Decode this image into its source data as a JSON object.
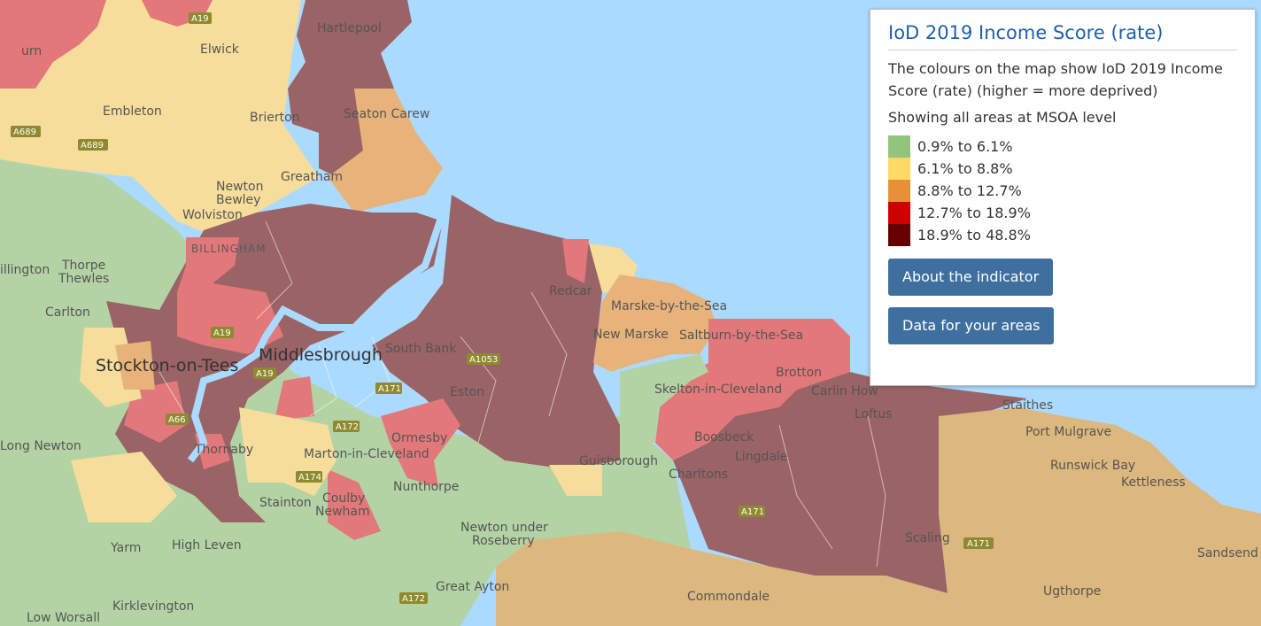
{
  "panel": {
    "title": "IoD 2019 Income Score (rate)",
    "description": "The colours on the map show IoD 2019 Income Score (rate) (higher = more deprived)",
    "level_text": "Showing all areas at MSOA level",
    "legend": [
      {
        "label": "0.9% to 6.1%",
        "color": "#93c47d"
      },
      {
        "label": "6.1% to 8.8%",
        "color": "#ffd966"
      },
      {
        "label": "8.8% to 12.7%",
        "color": "#e69138"
      },
      {
        "label": "12.7% to 18.9%",
        "color": "#cc0000"
      },
      {
        "label": "18.9% to 48.8%",
        "color": "#660000"
      }
    ],
    "buttons": {
      "about": "About the indicator",
      "data": "Data for your areas"
    }
  },
  "map": {
    "places": {
      "hartlepool": "Hartlepool",
      "elwick": "Elwick",
      "embleton": "Embleton",
      "brierton": "Brierton",
      "seaton_carew": "Seaton Carew",
      "greatham": "Greatham",
      "newton": "Newton",
      "bewley": "Bewley",
      "wolviston": "Wolviston",
      "billingham": "BILLINGHAM",
      "thorpe": "Thorpe",
      "thewles": "Thewles",
      "illington": "illington",
      "carlton": "Carlton",
      "stockton": "Stockton-on-Tees",
      "middlesbrough": "Middlesbrough",
      "south_bank": "South Bank",
      "redcar": "Redcar",
      "marske": "Marske-by-the-Sea",
      "new_marske": "New Marske",
      "saltburn": "Saltburn-by-the-Sea",
      "brotton": "Brotton",
      "carlin_how": "Carlin How",
      "loftus": "Loftus",
      "staithes": "Staithes",
      "port_mulgrave": "Port Mulgrave",
      "runswick_bay": "Runswick Bay",
      "kettleness": "Kettleness",
      "skelton": "Skelton-in-Cleveland",
      "boosbeck": "Boosbeck",
      "lingdale": "Lingdale",
      "charltons": "Charltons",
      "guisborough": "Guisborough",
      "eston": "Eston",
      "ormesby": "Ormesby",
      "marton": "Marton-in-Cleveland",
      "nunthorpe": "Nunthorpe",
      "thornaby": "Thornaby",
      "stainton": "Stainton",
      "coulby": "Coulby",
      "newham": "Newham",
      "long_newton": "Long Newton",
      "newton_under": "Newton under",
      "roseberry": "Roseberry",
      "yarm": "Yarm",
      "high_leven": "High Leven",
      "great_ayton": "Great Ayton",
      "kirklevington": "Kirklevington",
      "low_worsall": "Low Worsall",
      "commondale": "Commondale",
      "ugthorpe": "Ugthorpe",
      "scaling": "Scaling",
      "sandsend": "Sandsend",
      "urn": "urn"
    },
    "roads": {
      "a19a": "A19",
      "a689": "A689",
      "a689b": "A689",
      "a19b": "A19",
      "a19c": "A19",
      "a1053": "A1053",
      "a171a": "A171",
      "a66": "A66",
      "a172a": "A172",
      "a174": "A174",
      "a171b": "A171",
      "a171c": "A171",
      "a172b": "A172"
    }
  }
}
